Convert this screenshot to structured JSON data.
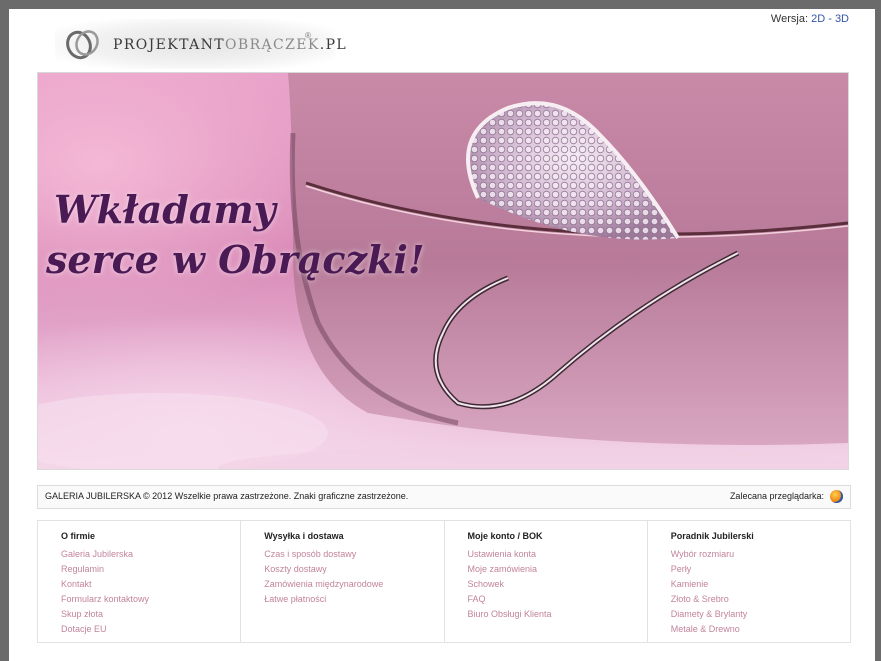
{
  "header": {
    "logo_main": "PROJEKTANT",
    "logo_accent": "OBRĄCZEK",
    "logo_suffix": ".PL",
    "logo_reg": "®",
    "version_label": "Wersja:",
    "version_2d": "2D",
    "version_sep": "-",
    "version_3d": "3D"
  },
  "hero": {
    "slogan_line1": "Wkładamy",
    "slogan_line2": "serce w Obrączki!"
  },
  "infobar": {
    "copyright": "GALERIA JUBILERSKA © 2012 Wszelkie prawa zastrzeżone. Znaki graficzne zastrzeżone.",
    "browser_label": "Zalecana przeglądarka:"
  },
  "columns": [
    {
      "title": "O firmie",
      "items": [
        "Galeria Jubilerska",
        "Regulamin",
        "Kontakt",
        "Formularz kontaktowy",
        "Skup złota",
        "Dotacje EU"
      ]
    },
    {
      "title": "Wysyłka i dostawa",
      "items": [
        "Czas i sposób dostawy",
        "Koszty dostawy",
        "Zamówienia międzynarodowe",
        "Łatwe płatności"
      ]
    },
    {
      "title": "Moje konto / BOK",
      "items": [
        "Ustawienia konta",
        "Moje zamówienia",
        "Schowek",
        "FAQ",
        "Biuro Obsługi Klienta"
      ]
    },
    {
      "title": "Poradnik Jubilerski",
      "items": [
        "Wybór rozmiaru",
        "Perły",
        "Kamienie",
        "Złoto & Srebro",
        "Diamety & Brylanty",
        "Metale & Drewno"
      ]
    }
  ]
}
